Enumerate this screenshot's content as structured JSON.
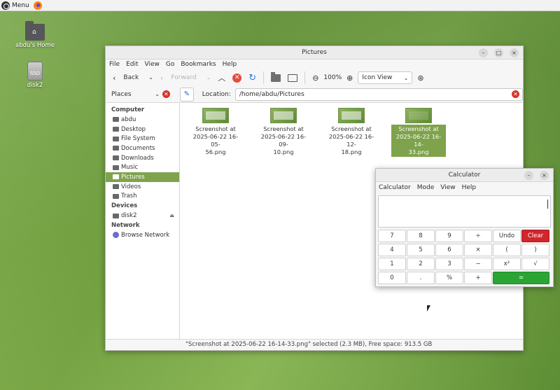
{
  "panel": {
    "menu_label": "Menu"
  },
  "desktop": {
    "icons": [
      {
        "label": "abdu's Home",
        "glyph": "⌂"
      },
      {
        "label": "disk2",
        "glyph": "SSD"
      }
    ]
  },
  "files": {
    "title": "Pictures",
    "menu": [
      "File",
      "Edit",
      "View",
      "Go",
      "Bookmarks",
      "Help"
    ],
    "toolbar": {
      "back": "Back",
      "forward": "Forward",
      "zoom": "100%",
      "view": "Icon View"
    },
    "places_label": "Places",
    "location_label": "Location:",
    "location_value": "/home/abdu/Pictures",
    "sidebar": {
      "computer_header": "Computer",
      "computer_items": [
        "abdu",
        "Desktop",
        "File System",
        "Documents",
        "Downloads",
        "Music",
        "Pictures",
        "Videos",
        "Trash"
      ],
      "devices_header": "Devices",
      "devices_items": [
        "disk2"
      ],
      "network_header": "Network",
      "network_items": [
        "Browse Network"
      ]
    },
    "items": [
      {
        "name": "Screenshot at 2025-06-22 16-05-56.png",
        "lines": [
          "Screenshot at",
          "2025-06-22 16-05-",
          "56.png"
        ]
      },
      {
        "name": "Screenshot at 2025-06-22 16-09-10.png",
        "lines": [
          "Screenshot at",
          "2025-06-22 16-09-",
          "10.png"
        ]
      },
      {
        "name": "Screenshot at 2025-06-22 16-12-18.png",
        "lines": [
          "Screenshot at",
          "2025-06-22 16-12-",
          "18.png"
        ]
      },
      {
        "name": "Screenshot at 2025-06-22 16-14-33.png",
        "lines": [
          "Screenshot at",
          "2025-06-22 16-14-",
          "33.png"
        ]
      }
    ],
    "status": "\"Screenshot at 2025-06-22 16-14-33.png\" selected (2.3 MB), Free space: 913.5 GB"
  },
  "calculator": {
    "title": "Calculator",
    "menu": [
      "Calculator",
      "Mode",
      "View",
      "Help"
    ],
    "display_value": "",
    "keys": [
      "7",
      "8",
      "9",
      "÷",
      "Undo",
      "Clear",
      "4",
      "5",
      "6",
      "×",
      "(",
      ")",
      "1",
      "2",
      "3",
      "−",
      "x²",
      "√",
      "0",
      ".",
      "%",
      "+",
      "="
    ]
  },
  "colors": {
    "selection": "#7fa34d",
    "clear_key": "#d0262c",
    "equals_key": "#2aa534"
  }
}
